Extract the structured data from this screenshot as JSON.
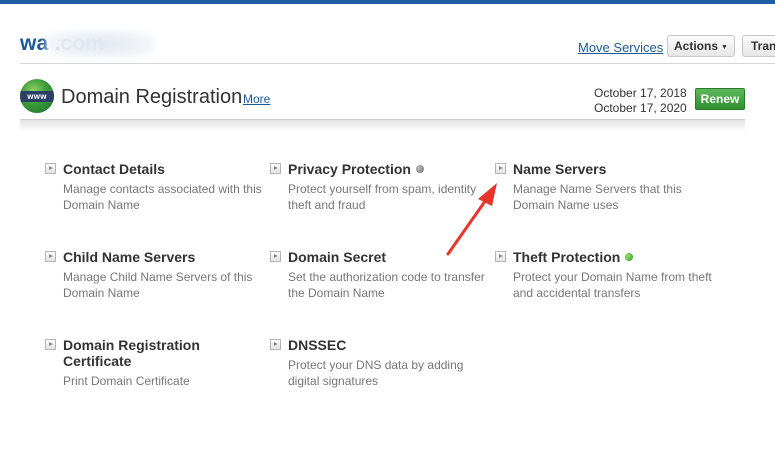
{
  "header": {
    "domain_name": "wa          .com",
    "move_services": "Move Services",
    "actions_label": "Actions",
    "transfer_label": "Tran"
  },
  "registration": {
    "icon_text": "www",
    "title": "Domain Registration",
    "more_link": "More",
    "date_registered": "October 17, 2018",
    "date_expires": "October 17, 2020",
    "renew_label": "Renew"
  },
  "items": [
    {
      "title": "Contact Details",
      "desc": "Manage contacts associated with this Domain Name"
    },
    {
      "title": "Privacy Protection",
      "desc": "Protect yourself from spam, identity theft and fraud",
      "status": "gray"
    },
    {
      "title": "Name Servers",
      "desc": "Manage Name Servers that this Domain Name uses"
    },
    {
      "title": "Child Name Servers",
      "desc": "Manage Child Name Servers of this Domain Name"
    },
    {
      "title": "Domain Secret",
      "desc": "Set the authorization code to transfer the Domain Name"
    },
    {
      "title": "Theft Protection",
      "desc": "Protect your Domain Name from theft and accidental transfers",
      "status": "green"
    },
    {
      "title": "Domain Registration Certificate",
      "desc": "Print Domain Certificate"
    },
    {
      "title": "DNSSEC",
      "desc": "Protect your DNS data by adding digital signatures"
    }
  ],
  "annotation": {
    "arrow_color": "#e8352a"
  },
  "colors": {
    "link": "#1c5a97",
    "renew": "#3a9b3a",
    "topbar": "#1f5fa6"
  }
}
